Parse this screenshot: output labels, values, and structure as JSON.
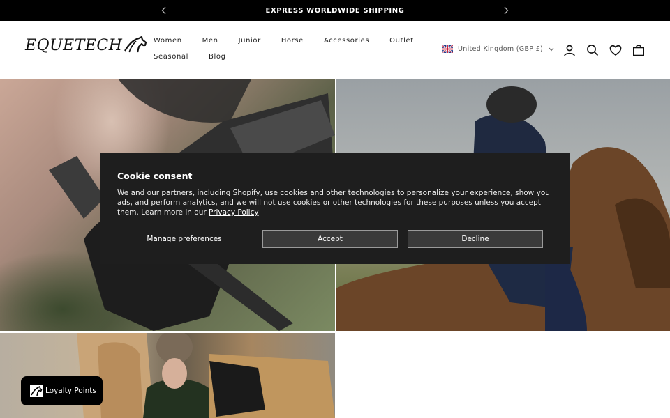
{
  "announcement": {
    "text": "EXPRESS WORLDWIDE SHIPPING"
  },
  "brand": {
    "name": "EQUETECH"
  },
  "nav": {
    "row1": [
      "Women",
      "Men",
      "Junior",
      "Horse",
      "Accessories",
      "Outlet"
    ],
    "row2": [
      "Seasonal",
      "Blog"
    ]
  },
  "country_selector": {
    "label": "United Kingdom (GBP £)",
    "flag": "uk-flag-icon"
  },
  "header_icons": [
    "account-icon",
    "search-icon",
    "wishlist-heart-icon",
    "cart-bag-icon"
  ],
  "cookie": {
    "title": "Cookie consent",
    "body": "We and our partners, including Shopify, use cookies and other technologies to personalize your experience, show you ads, and perform analytics, and we will not use cookies or other technologies for these purposes unless you accept them. Learn more in our",
    "link": "Privacy Policy",
    "manage": "Manage preferences",
    "accept": "Accept",
    "decline": "Decline"
  },
  "loyalty": {
    "label": "Loyalty Points"
  },
  "colors": {
    "announcement_bg": "#000000",
    "cookie_bg": "#1e1e1e",
    "button_bg": "#3a3a3a"
  }
}
